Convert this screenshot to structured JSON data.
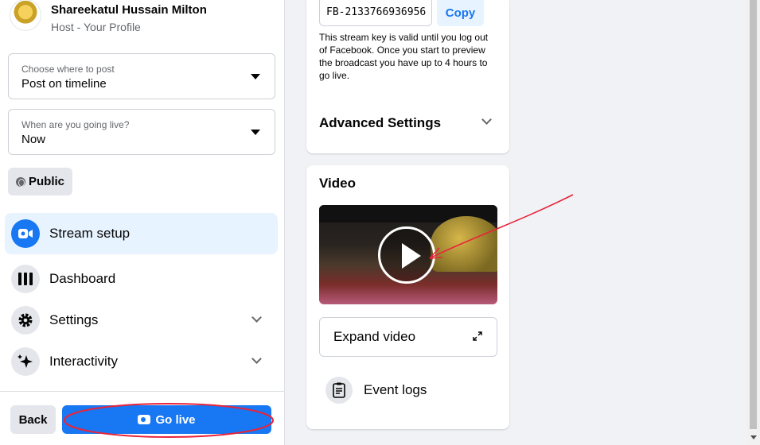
{
  "profile": {
    "name": "Shareekatul Hussain Milton",
    "role": "Host - Your Profile"
  },
  "post_target": {
    "label": "Choose where to post",
    "value": "Post on timeline"
  },
  "go_live_time": {
    "label": "When are you going live?",
    "value": "Now"
  },
  "audience": {
    "label": "Public"
  },
  "nav": {
    "items": [
      {
        "label": "Stream setup",
        "icon": "video-camera-icon",
        "active": true
      },
      {
        "label": "Dashboard",
        "icon": "dashboard-bars-icon"
      },
      {
        "label": "Settings",
        "icon": "gear-icon"
      },
      {
        "label": "Interactivity",
        "icon": "sparkle-icon"
      }
    ]
  },
  "footer": {
    "back_label": "Back",
    "go_live_label": "Go live"
  },
  "stream_key": {
    "value": "FB-2133766936956",
    "copy_label": "Copy",
    "note": "This stream key is valid until you log out of Facebook. Once you start to preview the broadcast you have up to 4 hours to go live."
  },
  "advanced": {
    "title": "Advanced Settings"
  },
  "video": {
    "title": "Video",
    "expand_label": "Expand video",
    "event_logs_label": "Event logs"
  },
  "colors": {
    "accent": "#1877f2",
    "annotation": "#e8243a"
  }
}
